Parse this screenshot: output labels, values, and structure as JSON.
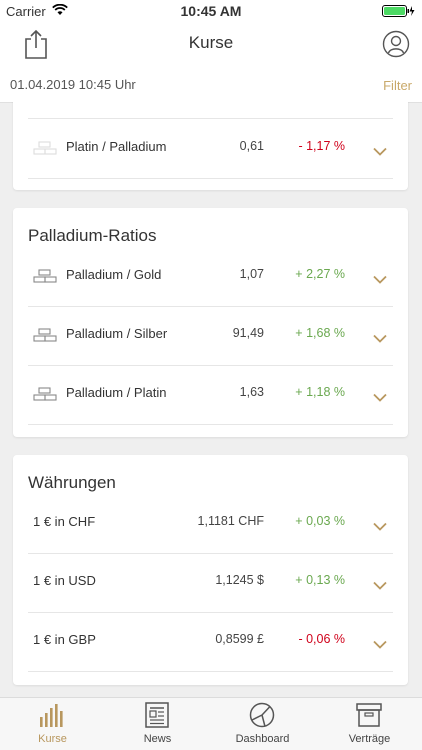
{
  "status": {
    "carrier": "Carrier",
    "time": "10:45 AM"
  },
  "nav": {
    "title": "Kurse"
  },
  "header": {
    "date": "01.04.2019 10:45 Uhr",
    "filter": "Filter"
  },
  "colors": {
    "accent": "#b8975e",
    "positive": "#6aa84f",
    "negative": "#d0021b"
  },
  "sections": [
    {
      "title": "",
      "rows": [
        {
          "name": "Platin / Palladium",
          "value": "0,61",
          "change": "- 1,17 %",
          "trend": "negative",
          "icon": "bars-icon"
        }
      ]
    },
    {
      "title": "Palladium-Ratios",
      "rows": [
        {
          "name": "Palladium / Gold",
          "value": "1,07",
          "change": "+ 2,27 %",
          "trend": "positive",
          "icon": "bars-icon"
        },
        {
          "name": "Palladium / Silber",
          "value": "91,49",
          "change": "+ 1,68 %",
          "trend": "positive",
          "icon": "bars-icon"
        },
        {
          "name": "Palladium / Platin",
          "value": "1,63",
          "change": "+ 1,18 %",
          "trend": "positive",
          "icon": "bars-icon"
        }
      ]
    },
    {
      "title": "Währungen",
      "rows": [
        {
          "name": "1 € in CHF",
          "value": "1,1181 CHF",
          "change": "+ 0,03 %",
          "trend": "positive"
        },
        {
          "name": "1 € in USD",
          "value": "1,1245 $",
          "change": "+ 0,13 %",
          "trend": "positive"
        },
        {
          "name": "1 € in GBP",
          "value": "0,8599 £",
          "change": "- 0,06 %",
          "trend": "negative"
        }
      ]
    }
  ],
  "tabs": [
    {
      "label": "Kurse",
      "icon": "chart-bars-icon",
      "active": true
    },
    {
      "label": "News",
      "icon": "newspaper-icon"
    },
    {
      "label": "Dashboard",
      "icon": "pie-chart-icon"
    },
    {
      "label": "Verträge",
      "icon": "archive-box-icon"
    }
  ]
}
